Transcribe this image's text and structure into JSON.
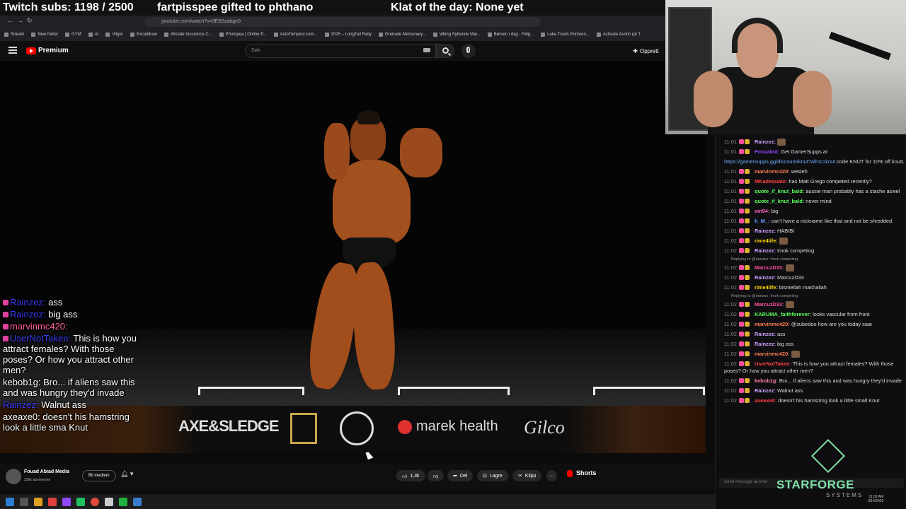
{
  "overlay": {
    "subs": "Twitch subs: 1198 / 2500",
    "gift": "fartpisspee gifted to phthano",
    "klat": "Klat of the day: None yet"
  },
  "browser": {
    "url": "youtube.com/watch?v=9E8Szabge0",
    "bookmarks": [
      "Stream",
      "New folder",
      "GYM",
      "AI",
      "Vitger",
      "Excalidraw",
      "Allstate Insurance C...",
      "Photopea | Online P...",
      "AutoTempest.com...",
      "2025 – LongTail Rally",
      "Grenade Mercenary...",
      "Viking Syttende Mai...",
      "Børsen i dag - Følg...",
      "Lake Travis Pontoon...",
      "Activate Austin (at T"
    ]
  },
  "youtube": {
    "logo_text": "Premium",
    "search_placeholder": "Søk",
    "create_label": "Opprett",
    "channel_name": "Fouad Abiad Media",
    "channel_subs": "326k abonnenter",
    "member_label": "Bli medlem",
    "likes": "1,3k",
    "share_label": "Del",
    "save_label": "Lagre",
    "clip_label": "Klipp",
    "more_label": "···",
    "shorts_label": "Shorts"
  },
  "sponsors": [
    "AXE&SLEDGE",
    "marek health",
    "Gilco"
  ],
  "left_chat": [
    {
      "name": "Rainzez:",
      "text": "ass",
      "color": "blue"
    },
    {
      "name": "Rainzez:",
      "text": "big ass",
      "color": "blue"
    },
    {
      "name": "marvinmc420:",
      "text": "",
      "color": "pink"
    },
    {
      "name": "UserNotTaken:",
      "text": "This is how you attract females? With those poses? Or how you attract other men?",
      "color": "blue"
    },
    {
      "name": "kebob1g:",
      "text": "Bro... if aliens saw this and was hungry they'd invade",
      "color": "white"
    },
    {
      "name": "Rainzez:",
      "text": "Walnut ass",
      "color": "blue"
    },
    {
      "name": "axeaxe0:",
      "text": "doesn't his hamstring look a little sma Knut",
      "color": "white"
    }
  ],
  "right_chat": [
    {
      "time": "11:01",
      "name": "Rainzez:",
      "text": "",
      "color": "#d2a0ff"
    },
    {
      "time": "11:01",
      "name": "Fossabot:",
      "text": "Get GamerSupps at",
      "color": "#9146ff"
    },
    {
      "time": "",
      "name": "",
      "text": "code KNUT for 10% off knutL",
      "link": "https://gamersupps.gg/discount/knut?afmc=knut",
      "color": "#fff"
    },
    {
      "time": "11:01",
      "name": "marvinmc420:",
      "text": "wesleh",
      "color": "#ff7f50"
    },
    {
      "time": "11:01",
      "name": "MKadequate:",
      "text": "has Matt Grego competed recently?",
      "color": "#ff4040"
    },
    {
      "time": "11:01",
      "name": "quote_if_knut_bald:",
      "text": "aussie man probably has a stache aswel",
      "color": "#5cff5c"
    },
    {
      "time": "11:01",
      "name": "quote_if_knut_bald:",
      "text": "never mind",
      "color": "#5cff5c"
    },
    {
      "time": "11:01",
      "name": "xm94:",
      "text": "big",
      "color": "#ff60c0"
    },
    {
      "time": "11:01",
      "name": "ti_M_:",
      "text": "can't have a nickname like that and not be shredded",
      "color": "#5ea0ff"
    },
    {
      "time": "11:01",
      "name": "Rainzez:",
      "text": "HABIBI",
      "color": "#d2a0ff"
    },
    {
      "time": "11:02",
      "name": "rime4life:",
      "text": "",
      "color": "#ffd700"
    },
    {
      "time": "11:02",
      "name": "Rainzez:",
      "text": "Imok competing",
      "color": "#d2a0ff"
    },
    {
      "time": "",
      "name": "",
      "text": "",
      "reply": "Replying to @rainzez: Imok competing",
      "color": "#999"
    },
    {
      "time": "11:02",
      "name": "MarcuzD33:",
      "text": "",
      "color": "#ff4fa0"
    },
    {
      "time": "11:02",
      "name": "Rainzez:",
      "text": "MarcuzD33",
      "color": "#d2a0ff"
    },
    {
      "time": "11:02",
      "name": "rime4life:",
      "text": "bismellah mashallah",
      "color": "#ffd700"
    },
    {
      "time": "",
      "name": "",
      "text": "",
      "reply": "Replying to @rainzez: Imok competing",
      "color": "#999"
    },
    {
      "time": "11:02",
      "name": "MarcuzD33:",
      "text": "",
      "color": "#ff4fa0"
    },
    {
      "time": "11:02",
      "name": "KARUMA_faithforever:",
      "text": "looks vascular from front",
      "color": "#5cff5c"
    },
    {
      "time": "11:02",
      "name": "marvinmc420:",
      "text": "@zubedoo how are you today saar",
      "color": "#ff7f50"
    },
    {
      "time": "11:02",
      "name": "Rainzez:",
      "text": "ass",
      "color": "#d2a0ff"
    },
    {
      "time": "11:02",
      "name": "Rainzez:",
      "text": "big ass",
      "color": "#d2a0ff"
    },
    {
      "time": "11:02",
      "name": "marvinmc420:",
      "text": "",
      "color": "#ff7f50"
    },
    {
      "time": "11:02",
      "name": "UserNotTaken:",
      "text": "This is how you attract females? With those poses? Or how you attract other men?",
      "color": "#ff4040"
    },
    {
      "time": "11:02",
      "name": "kebob1g:",
      "text": "Bro... if aliens saw this and was hungry they'd invade",
      "color": "#ff80a0"
    },
    {
      "time": "11:02",
      "name": "Rainzez:",
      "text": "Walnut ass",
      "color": "#d2a0ff"
    },
    {
      "time": "11:02",
      "name": "axeaxe0:",
      "text": "doesn't his hamstring look a little small Knut",
      "color": "#ff4040"
    }
  ],
  "chat_input_placeholder": "Send message as knut",
  "brand": {
    "name": "STARFORGE",
    "sub": "SYSTEMS"
  },
  "clock": {
    "time": "11:02 AM",
    "date": "3/14/2026"
  }
}
